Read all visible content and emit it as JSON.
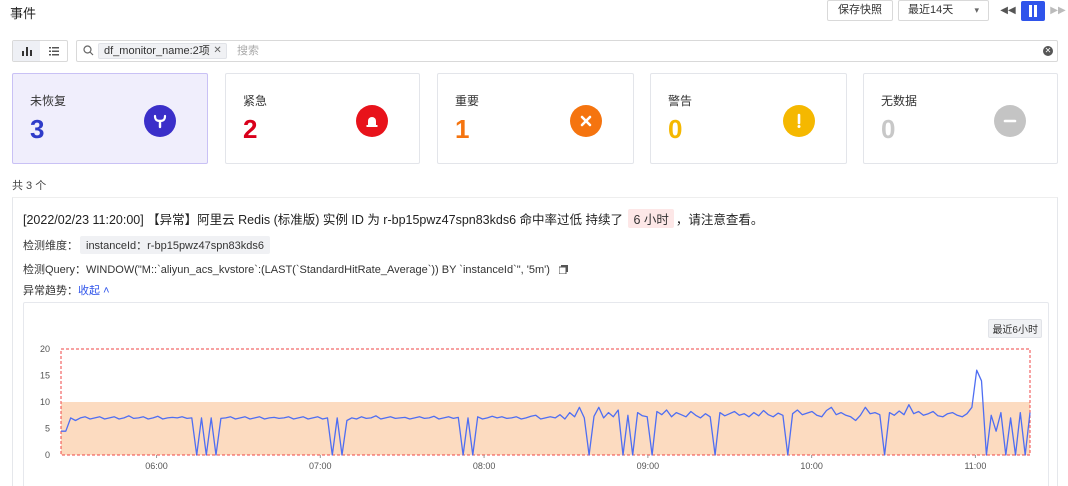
{
  "header": {
    "title": "事件",
    "save_snapshot": "保存快照",
    "time_range": "最近14天"
  },
  "search": {
    "chip": "df_monitor_name:2项",
    "placeholder": "搜索"
  },
  "stats": [
    {
      "label": "未恢复",
      "count": "3",
      "color": "#2f3bc9",
      "icon": "wrench-icon",
      "icon_bg": "#3b2fc9"
    },
    {
      "label": "紧急",
      "count": "2",
      "color": "#d9001b",
      "icon": "siren-icon",
      "icon_bg": "#e8131b"
    },
    {
      "label": "重要",
      "count": "1",
      "color": "#f5740f",
      "icon": "x-icon",
      "icon_bg": "#f5740f"
    },
    {
      "label": "警告",
      "count": "0",
      "color": "#f5b800",
      "icon": "exclamation-icon",
      "icon_bg": "#f5b800"
    },
    {
      "label": "无数据",
      "count": "0",
      "color": "#c8c8c8",
      "icon": "minus-icon",
      "icon_bg": "#c4c4c4"
    }
  ],
  "total": "共 3 个",
  "event": {
    "title_prefix": "[2022/02/23 11:20:00] 【异常】阿里云 Redis (标准版) 实例 ID 为 r-bp15pwz47spn83kds6 命中率过低 持续了",
    "duration": "6 小时",
    "title_suffix": "，请注意查看。",
    "dim_label": "检测维度：",
    "dim_value": "instanceId：r-bp15pwz47spn83kds6",
    "query_label": "检测Query：",
    "query_value": "WINDOW(\"M::`aliyun_acs_kvstore`:(LAST(`StandardHitRate_Average`)) BY `instanceId`\", '5m')",
    "trend_label": "异常趋势：",
    "collapse": "收起",
    "range_tag": "最近6小时"
  },
  "chart_data": {
    "type": "line",
    "ylim": [
      0,
      20
    ],
    "yticks": [
      0,
      5,
      10,
      15,
      20
    ],
    "xlim": [
      "05:25",
      "11:20"
    ],
    "x_ticks": [
      "06:00",
      "07:00",
      "08:00",
      "09:00",
      "10:00",
      "11:00"
    ],
    "threshold_band": [
      0,
      10
    ],
    "threshold_band_color": "#fcd5b5",
    "alert_box_color": "#ef4444",
    "line_color": "#4f6ef2",
    "series": [
      {
        "values": [
          4.5,
          4.5,
          7,
          6.5,
          7,
          7.2,
          6.8,
          7,
          7.2,
          6.8,
          7,
          7.2,
          6.8,
          7,
          7.4,
          6.9,
          7,
          7.2,
          6.8,
          7,
          7.3,
          6.8,
          7,
          7.1,
          7,
          7.2,
          6.9,
          7,
          0,
          7,
          0,
          7,
          0,
          6.9,
          7,
          7.2,
          6.8,
          7,
          7.2,
          6.8,
          7,
          7.2,
          6.8,
          7,
          7.1,
          6.9,
          7,
          7.2,
          6.8,
          7,
          7.2,
          6.8,
          7,
          7.2,
          6.8,
          7,
          0,
          7,
          0,
          6.5,
          7,
          6.8,
          7.2,
          6.9,
          7,
          7.4,
          6.8,
          7,
          7.2,
          6.9,
          7,
          7.1,
          6.8,
          7,
          7.2,
          6.9,
          7,
          7.3,
          6.8,
          7,
          7.2,
          6.9,
          7.1,
          0,
          7,
          0,
          7.2,
          6.8,
          7,
          7.3,
          7,
          7.2,
          6.9,
          7,
          7.2,
          6.8,
          7,
          7.3,
          7.5,
          6.8,
          7,
          7.2,
          7,
          7.6,
          6.8,
          8,
          7.2,
          9,
          7,
          0,
          7.3,
          9,
          7,
          8,
          7.2,
          8.5,
          0,
          7.5,
          0,
          8,
          7.4,
          7.2,
          0,
          8.2,
          7.6,
          8.5,
          7.2,
          8,
          7.6,
          7.2,
          8.2,
          7.5,
          7,
          7.8,
          7.2,
          0,
          8,
          7.4,
          7.8,
          8.2,
          7.5,
          7.8,
          7.2,
          8,
          7.4,
          8.4,
          7.6,
          7.2,
          7.9,
          7.5,
          0,
          7.8,
          8.5,
          7.6,
          7.9,
          8.2,
          7.5,
          7.2,
          8.4,
          9,
          7.6,
          8,
          7.5,
          7.2,
          6.5,
          7.5,
          9,
          7.8,
          8,
          7.6,
          0,
          8,
          7.5,
          8.3,
          7.6,
          9.5,
          7.8,
          8.2,
          7.5,
          7.8,
          8.2,
          7.4,
          7.2,
          7.8,
          8,
          7.5,
          7.2,
          7.8,
          9,
          16,
          14,
          0,
          7.5,
          4.5,
          8,
          0,
          7,
          0,
          8,
          0,
          8
        ]
      }
    ]
  }
}
